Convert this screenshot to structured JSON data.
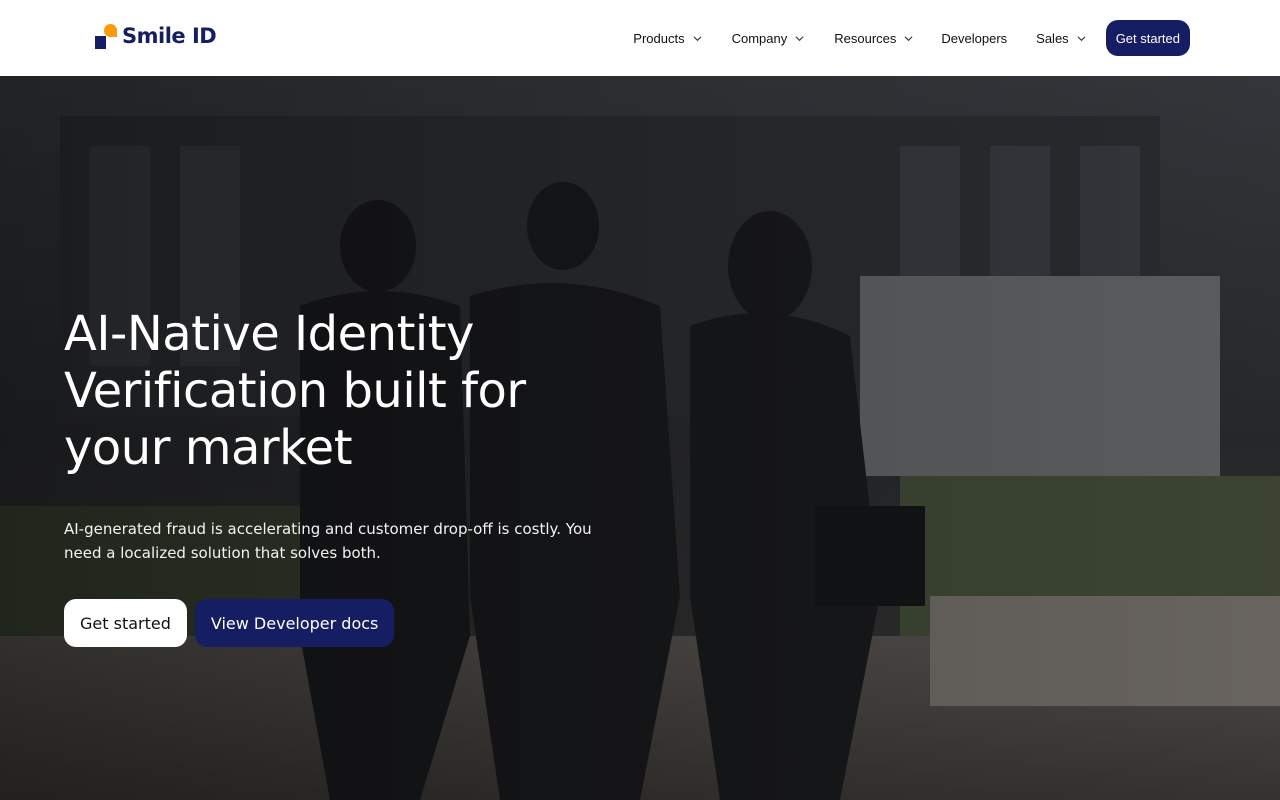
{
  "brand": {
    "name": "Smile ID",
    "colors": {
      "primary": "#151d63",
      "accent": "#ff9b00",
      "header_bg": "#ffffff"
    }
  },
  "nav": {
    "items": [
      {
        "label": "Products",
        "has_dropdown": true,
        "icon": "chevron-down-icon"
      },
      {
        "label": "Company",
        "has_dropdown": true,
        "icon": "chevron-down-icon"
      },
      {
        "label": "Resources",
        "has_dropdown": true,
        "icon": "chevron-down-icon"
      },
      {
        "label": "Developers",
        "has_dropdown": false
      },
      {
        "label": "Sales",
        "has_dropdown": true,
        "icon": "chevron-down-icon"
      }
    ],
    "cta_label": "Get started"
  },
  "hero": {
    "title": "AI-Native Identity Verification built for your market",
    "subtitle": "AI-generated fraud is accelerating and customer drop-off is costly. You need a localized solution that solves both.",
    "primary_cta": "Get started",
    "secondary_cta": "View Developer docs"
  }
}
